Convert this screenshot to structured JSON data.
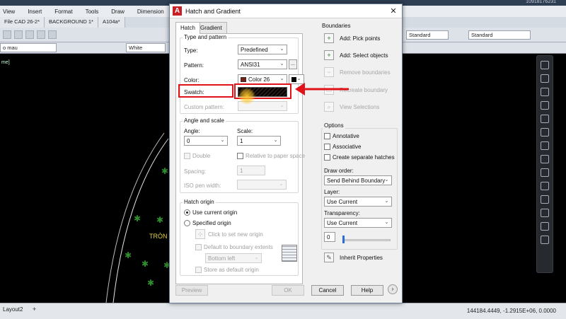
{
  "app": {
    "menu": [
      "View",
      "Insert",
      "Format",
      "Tools",
      "Draw",
      "Dimension"
    ],
    "title_right": "10918176231",
    "file_tabs": [
      "File CAD 26-2*",
      "BACKGROUND 1*",
      "A104a*"
    ],
    "layer_label": "o mau",
    "color_label": "White",
    "style_combo": "Standard",
    "style_combo2": "Standard",
    "canvas_label": "me]",
    "canvas_text": "TRÒN",
    "layout_tab": "Layout2",
    "coordinates": "144184.4449, -1.2915E+06, 0.0000"
  },
  "dialog": {
    "title": "Hatch and Gradient",
    "tabs": [
      "Hatch",
      "Gradient"
    ],
    "type_pattern": {
      "title": "Type and pattern",
      "type_label": "Type:",
      "type_value": "Predefined",
      "pattern_label": "Pattern:",
      "pattern_value": "ANSI31",
      "browse": "...",
      "color_label": "Color:",
      "color_value": "Color 26",
      "color_swatch_hex": "#7a1f14",
      "swatch_label": "Swatch:",
      "custom_label": "Custom pattern:"
    },
    "angle_scale": {
      "title": "Angle and scale",
      "angle_label": "Angle:",
      "angle_value": "0",
      "scale_label": "Scale:",
      "scale_value": "1",
      "double_label": "Double",
      "relative_label": "Relative to paper space",
      "spacing_label": "Spacing:",
      "spacing_value": "1",
      "iso_label": "ISO pen width:"
    },
    "origin": {
      "title": "Hatch origin",
      "use_current": "Use current origin",
      "specified": "Specified origin",
      "click_set": "Click to set new origin",
      "default_extents": "Default to boundary extents",
      "extents_value": "Bottom left",
      "store_default": "Store as default origin"
    },
    "boundaries": {
      "title": "Boundaries",
      "add_pick": "Add: Pick points",
      "add_select": "Add: Select objects",
      "remove": "Remove boundaries",
      "recreate": "Recreate boundary",
      "view_selections": "View Selections"
    },
    "options": {
      "title": "Options",
      "annotative": "Annotative",
      "associative": "Associative",
      "separate": "Create separate hatches",
      "draw_order_label": "Draw order:",
      "draw_order_value": "Send Behind Boundary",
      "layer_label": "Layer:",
      "layer_value": "Use Current",
      "transparency_label": "Transparency:",
      "transparency_value": "Use Current",
      "transparency_number": "0",
      "transparency_level": 0
    },
    "inherit": "Inherit Properties",
    "buttons": {
      "preview": "Preview",
      "ok": "OK",
      "cancel": "Cancel",
      "help": "Help"
    }
  }
}
